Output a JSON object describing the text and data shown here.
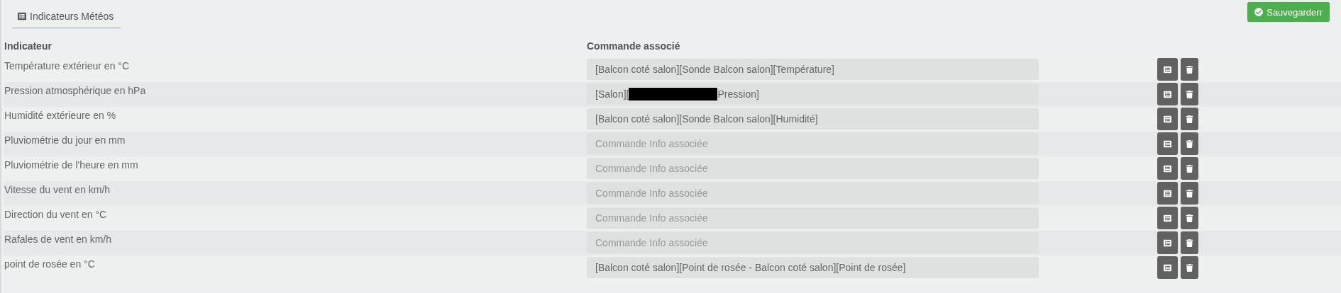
{
  "tabs": [
    {
      "label": "Indicateurs Météos",
      "selected": true
    }
  ],
  "save_button": {
    "label": "Sauvegarderr"
  },
  "table": {
    "columns": [
      "Indicateur",
      "Commande associé"
    ],
    "rows": [
      {
        "indicator": "Température extérieur en °C",
        "command": {
          "value": "[Balcon coté salon][Sonde Balcon salon][Température]"
        }
      },
      {
        "indicator": "Pression atmosphérique en hPa",
        "command": {
          "value": "[Salon][",
          "redacted": true,
          "value_end": "Pression]"
        }
      },
      {
        "indicator": "Humidité extérieure en %",
        "command": {
          "value": "[Balcon coté salon][Sonde Balcon salon][Humidité]"
        }
      },
      {
        "indicator": "Pluviométrie du jour en mm",
        "command": {
          "placeholder": "Commande Info associée"
        }
      },
      {
        "indicator": "Pluviométrie de l'heure en mm",
        "command": {
          "placeholder": "Commande Info associée"
        }
      },
      {
        "indicator": "Vitesse du vent en km/h",
        "command": {
          "placeholder": "Commande Info associée"
        }
      },
      {
        "indicator": "Direction du vent en °C",
        "command": {
          "placeholder": "Commande Info associée"
        }
      },
      {
        "indicator": "Rafales de vent en km/h",
        "command": {
          "placeholder": "Commande Info associée"
        }
      },
      {
        "indicator": "point de rosée en °C",
        "command": {
          "value": "[Balcon coté salon][Point de rosée - Balcon coté salon][Point de rosée]"
        }
      }
    ]
  }
}
